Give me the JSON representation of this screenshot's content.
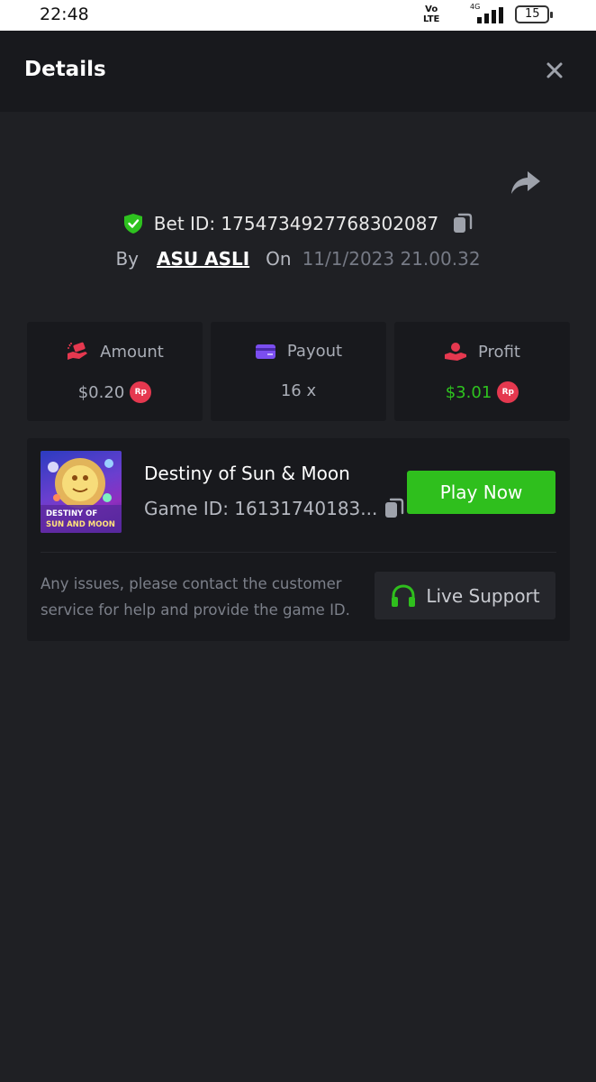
{
  "status_bar": {
    "time": "22:48",
    "volte_line1": "Vo",
    "volte_line2": "LTE",
    "network": "4G",
    "battery": "15"
  },
  "header": {
    "title": "Details",
    "close_icon": "close-icon"
  },
  "bet": {
    "id_text": "Bet ID: 1754734927768302087",
    "by_label": "By",
    "user": "ASU ASLI",
    "on_label": "On",
    "date": "11/1/2023 21.00.32"
  },
  "stats": {
    "amount": {
      "label": "Amount",
      "value": "$0.20",
      "currency": "Rp",
      "icon": "money-hand-icon",
      "icon_color": "#e5384f"
    },
    "payout": {
      "label": "Payout",
      "value": "16 x",
      "icon": "card-icon",
      "icon_color": "#7b4ef0"
    },
    "profit": {
      "label": "Profit",
      "value": "$3.01",
      "currency": "Rp",
      "icon": "hand-coin-icon",
      "icon_color": "#e5384f",
      "value_color": "#2ec21f"
    }
  },
  "game": {
    "title": "Destiny of Sun & Moon",
    "id_text": "Game ID: 16131740183...",
    "thumb_line1": "DESTINY OF",
    "thumb_line2": "SUN AND MOON",
    "play_label": "Play Now",
    "support_text": "Any issues, please contact the customer service for help and provide the game ID.",
    "live_support_label": "Live Support"
  },
  "colors": {
    "background": "#1f2024",
    "card": "#18191d",
    "accent_green": "#2fbf1d",
    "rp_badge": "#e5384f"
  }
}
